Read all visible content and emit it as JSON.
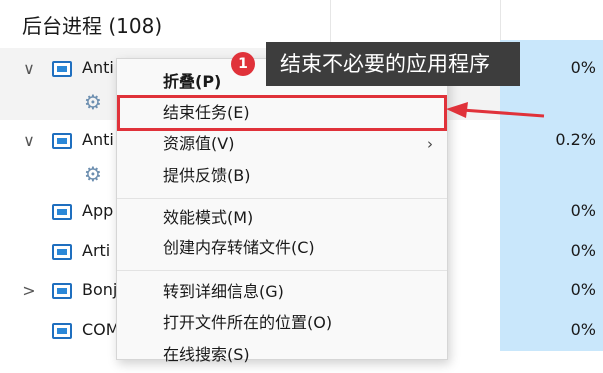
{
  "header": {
    "title": "后台进程 (108)"
  },
  "processes": [
    {
      "name": "Anti",
      "cpu": "0%",
      "expand": "∨"
    },
    {
      "name": "Anti",
      "cpu": "0.2%",
      "expand": "∨"
    },
    {
      "name": "App",
      "cpu": "0%",
      "expand": ""
    },
    {
      "name": "Arti",
      "cpu": "0%",
      "expand": ""
    },
    {
      "name": "Bonj",
      "cpu": "0%",
      "expand": ">"
    },
    {
      "name": "COM",
      "cpu": "0%",
      "expand": ""
    }
  ],
  "context_menu": {
    "items": [
      {
        "label": "折叠(P)",
        "bold": true
      },
      {
        "label": "结束任务(E)",
        "highlighted": true
      },
      {
        "label": "资源值(V)",
        "submenu": "›"
      },
      {
        "label": "提供反馈(B)"
      },
      {
        "label": "效能模式(M)"
      },
      {
        "label": "创建内存转储文件(C)"
      },
      {
        "label": "转到详细信息(G)"
      },
      {
        "label": "打开文件所在的位置(O)"
      },
      {
        "label": "在线搜索(S)"
      }
    ]
  },
  "annotation": {
    "badge": "1",
    "text": "结束不必要的应用程序",
    "color": "#e0323a"
  }
}
